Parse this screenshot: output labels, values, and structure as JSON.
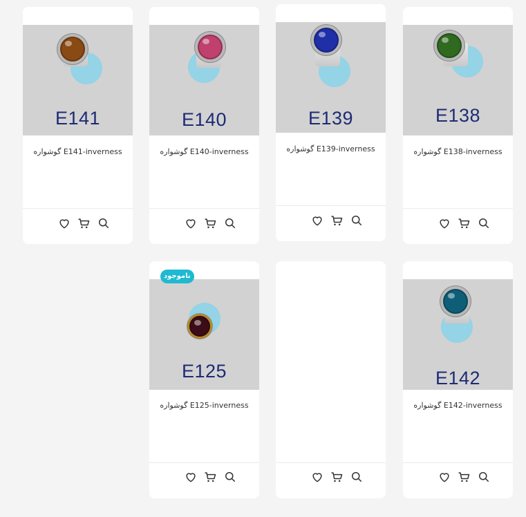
{
  "products": [
    {
      "code": "E141",
      "title": "گوشواره E141-inverness",
      "gem_color": "#8a4a14"
    },
    {
      "code": "E140",
      "title": "گوشواره E140-inverness",
      "gem_color": "#c0406e"
    },
    {
      "code": "E139",
      "title": "گوشواره E139-inverness",
      "gem_color": "#1e2fa8"
    },
    {
      "code": "E138",
      "title": "گوشواره E138-inverness",
      "gem_color": "#2f6a20"
    },
    {
      "code": "E125",
      "title": "گوشواره E125-inverness",
      "gem_color": "#3c0d16",
      "badge": "ناموجود"
    },
    {
      "code": "E142",
      "title": "گوشواره E142-inverness",
      "gem_color": "#0f5e78"
    }
  ],
  "actions": {
    "wishlist_icon": "heart-icon",
    "cart_icon": "cart-icon",
    "quickview_icon": "search-icon"
  }
}
